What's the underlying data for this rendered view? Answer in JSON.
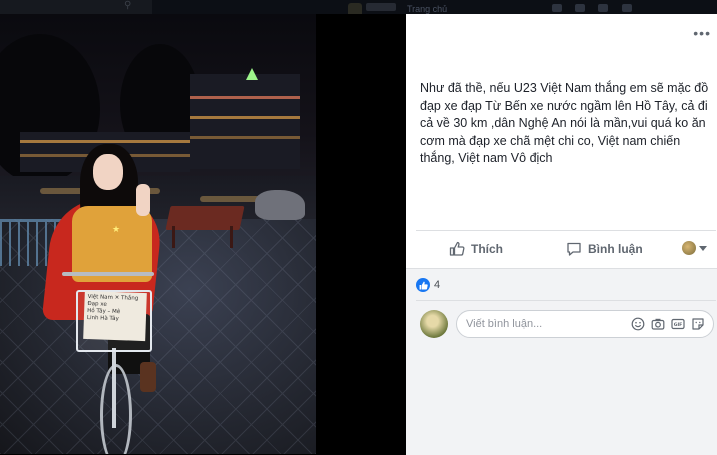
{
  "topbar": {
    "home_label": "Trang chủ"
  },
  "photo": {
    "sign_lines": [
      "Việt Nam ✕ Thắng",
      "Đạp xe",
      "Hồ Tây – Mê",
      "Linh Hà Tây"
    ]
  },
  "post": {
    "caption": "Như đã thề, nếu U23 Việt Nam thắng em sẽ mặc đồ đạp xe đạp Từ Bến xe nước ngầm lên Hồ Tây, cả đi cả về 30 km ,dân Nghệ An nói là mần,vui quá ko ăn cơm mà đạp xe chã mệt chi co, Việt nam chiến thắng, Việt nam Vô địch",
    "more_icon": "ellipsis-icon"
  },
  "actions": {
    "like_label": "Thích",
    "comment_label": "Bình luận",
    "like_icon": "thumbs-up-icon",
    "comment_icon": "speech-bubble-icon"
  },
  "reactions": {
    "count": "4",
    "icon": "like-reaction-icon",
    "color": "#1877f2"
  },
  "comment_composer": {
    "placeholder": "Viết bình luận...",
    "icons": [
      "emoji-icon",
      "camera-icon",
      "gif-icon",
      "sticker-icon"
    ]
  }
}
